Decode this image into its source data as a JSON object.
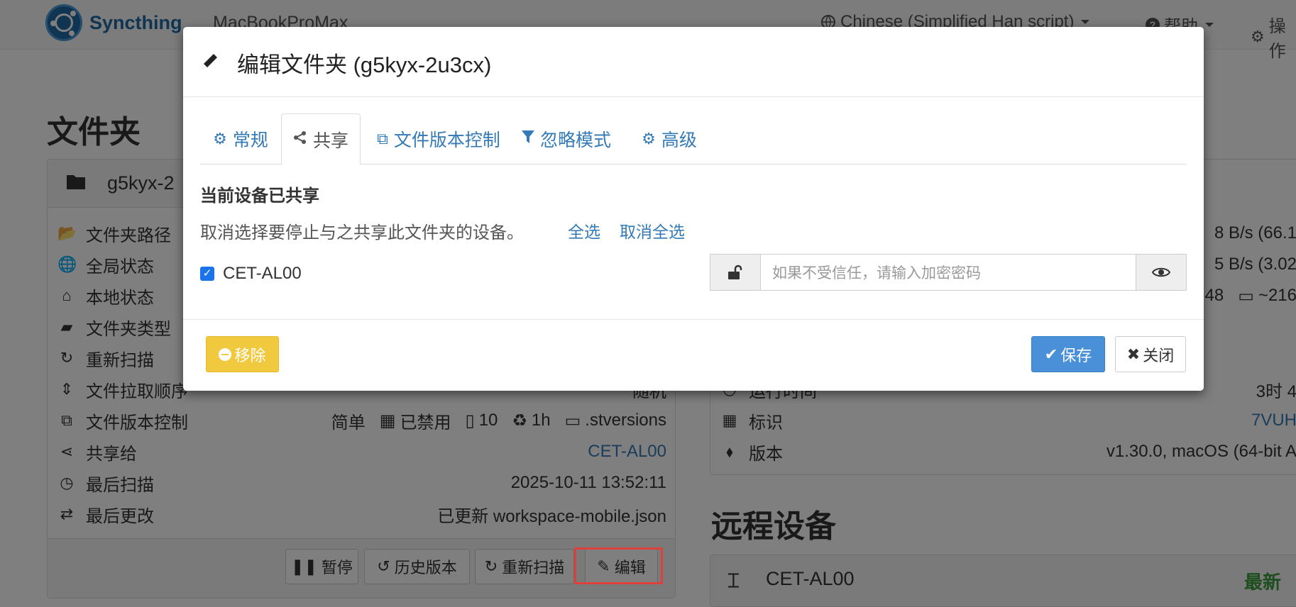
{
  "navbar": {
    "brand": "Syncthing",
    "device": "MacBookProMax",
    "language": "Chinese (Simplified Han script)",
    "help": "帮助",
    "actions": "操作"
  },
  "folders": {
    "section_title": "文件夹",
    "folder_heading": "g5kyx-2",
    "rows": [
      {
        "label": "文件夹路径",
        "value": ""
      },
      {
        "label": "全局状态",
        "value": ""
      },
      {
        "label": "本地状态",
        "value": ""
      },
      {
        "label": "文件夹类型",
        "value": ""
      },
      {
        "label": "重新扫描",
        "value": ""
      },
      {
        "label": "文件拉取顺序",
        "value": "随机"
      },
      {
        "label": "文件版本控制",
        "value": ""
      },
      {
        "label": "共享给",
        "value": "CET-AL00"
      },
      {
        "label": "最后扫描",
        "value": "2025-10-11 13:52:11"
      },
      {
        "label": "最后更改",
        "value": "已更新 workspace-mobile.json"
      }
    ],
    "versioning": {
      "type": "简单",
      "cleanup": "已禁用",
      "keep": "10",
      "interval": "1h",
      "path": ".stversions"
    },
    "buttons": {
      "pause": "暂停",
      "history": "历史版本",
      "rescan": "重新扫描",
      "edit": "编辑"
    }
  },
  "this_device": {
    "rows": [
      {
        "label": "",
        "value": "8 B/s (66.1"
      },
      {
        "label": "",
        "value": "5 B/s (3.02"
      },
      {
        "label": "",
        "value": "48"
      },
      {
        "label": "运行时间",
        "value": "3时 4"
      },
      {
        "label": "标识",
        "value": "7VUH"
      },
      {
        "label": "版本",
        "value": "v1.30.0, macOS (64-bit A"
      }
    ],
    "disk": "~216"
  },
  "remote_devices": {
    "section_title": "远程设备",
    "device_name": "CET-AL00",
    "status": "最新"
  },
  "modal": {
    "title": "编辑文件夹 (g5kyx-2u3cx)",
    "tabs": [
      {
        "label": "常规",
        "icon": "gear-icon"
      },
      {
        "label": "共享",
        "icon": "share-icon"
      },
      {
        "label": "文件版本控制",
        "icon": "copy-icon"
      },
      {
        "label": "忽略模式",
        "icon": "filter-icon"
      },
      {
        "label": "高级",
        "icon": "cogs-icon"
      }
    ],
    "shared_title": "当前设备已共享",
    "description": "取消选择要停止与之共享此文件夹的设备。",
    "select_all": "全选",
    "deselect_all": "取消全选",
    "device": "CET-AL00",
    "password_placeholder": "如果不受信任，请输入加密密码",
    "remove": "移除",
    "save": "保存",
    "close": "关闭"
  },
  "colors": {
    "link": "#337ab7",
    "warning": "#f0c93e",
    "primary": "#4a90d9",
    "success": "#3c9a3c",
    "highlight": "#e0403c"
  }
}
